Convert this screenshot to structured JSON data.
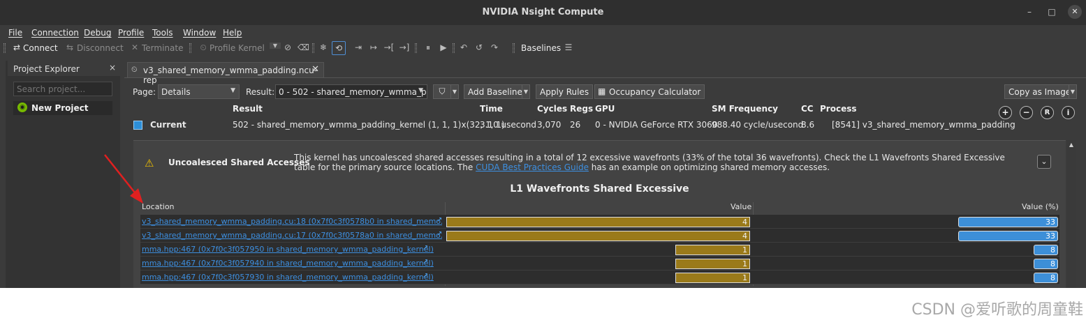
{
  "app": {
    "title": "NVIDIA Nsight Compute"
  },
  "window_controls": {
    "minimize": "–",
    "maximize": "□",
    "close": "✕"
  },
  "menu": [
    "File",
    "Connection",
    "Debug",
    "Profile",
    "Tools",
    "Window",
    "Help"
  ],
  "toolbar": {
    "connect": "Connect",
    "disconnect": "Disconnect",
    "terminate": "Terminate",
    "profile_kernel": "Profile Kernel",
    "baselines": "Baselines"
  },
  "sidebar": {
    "title": "Project Explorer",
    "close": "×",
    "search_placeholder": "Search project...",
    "project": "New Project"
  },
  "tab": {
    "label": "v3_shared_memory_wmma_padding.ncu-rep",
    "close": "✕"
  },
  "controls": {
    "page_label": "Page:",
    "page_value": "Details",
    "result_label": "Result:",
    "result_value": "0 -   502 - shared_memory_wmma_pa",
    "add_baseline": "Add Baseline",
    "apply_rules": "Apply Rules",
    "occupancy": "Occupancy Calculator",
    "copy_image": "Copy as Image"
  },
  "summary": {
    "headers": {
      "result": "Result",
      "time": "Time",
      "cycles": "Cycles",
      "regs": "Regs",
      "gpu": "GPU",
      "sm_freq": "SM Frequency",
      "cc": "CC",
      "process": "Process"
    },
    "current_label": "Current",
    "current_color": "#2d8fd8",
    "result": "502 - shared_memory_wmma_padding_kernel (1, 1, 1)x(32, 1, 1)",
    "time": "3.10 usecond",
    "cycles": "3,070",
    "regs": "26",
    "gpu": "0 - NVIDIA GeForce RTX 3060",
    "sm_freq": "988.40 cycle/usecond",
    "cc": "8.6",
    "process": "[8541] v3_shared_memory_wmma_padding"
  },
  "warning": {
    "title": "Uncoalesced Shared Accesses",
    "text_before": "This kernel has uncoalesced shared accesses resulting in a total of 12 excessive wavefronts (33% of the total 36 wavefronts). Check the L1 Wavefronts Shared Excessive table for the primary source locations. The ",
    "link": "CUDA Best Practices Guide",
    "text_after": " has an example on optimizing shared memory accesses."
  },
  "table": {
    "title": "L1 Wavefronts Shared Excessive",
    "columns": [
      "Location",
      "Value",
      "Value (%)"
    ],
    "value_max": 4,
    "pct_max": 33,
    "bar_color": "#9a7a1a",
    "pct_color": "#3d8fd8",
    "rows": [
      {
        "location": "v3_shared_memory_wmma_padding.cu:18 (0x7f0c3f0578b0 in shared_memo...",
        "value": 4,
        "pct": 33
      },
      {
        "location": "v3_shared_memory_wmma_padding.cu:17 (0x7f0c3f0578a0 in shared_memo...",
        "value": 4,
        "pct": 33
      },
      {
        "location": "mma.hpp:467 (0x7f0c3f057950 in shared_memory_wmma_padding_kernel)",
        "value": 1,
        "pct": 8
      },
      {
        "location": "mma.hpp:467 (0x7f0c3f057940 in shared_memory_wmma_padding_kernel)",
        "value": 1,
        "pct": 8
      },
      {
        "location": "mma.hpp:467 (0x7f0c3f057930 in shared_memory_wmma_padding_kernel)",
        "value": 1,
        "pct": 8
      }
    ]
  },
  "watermark": "CSDN @爱听歌的周童鞋"
}
